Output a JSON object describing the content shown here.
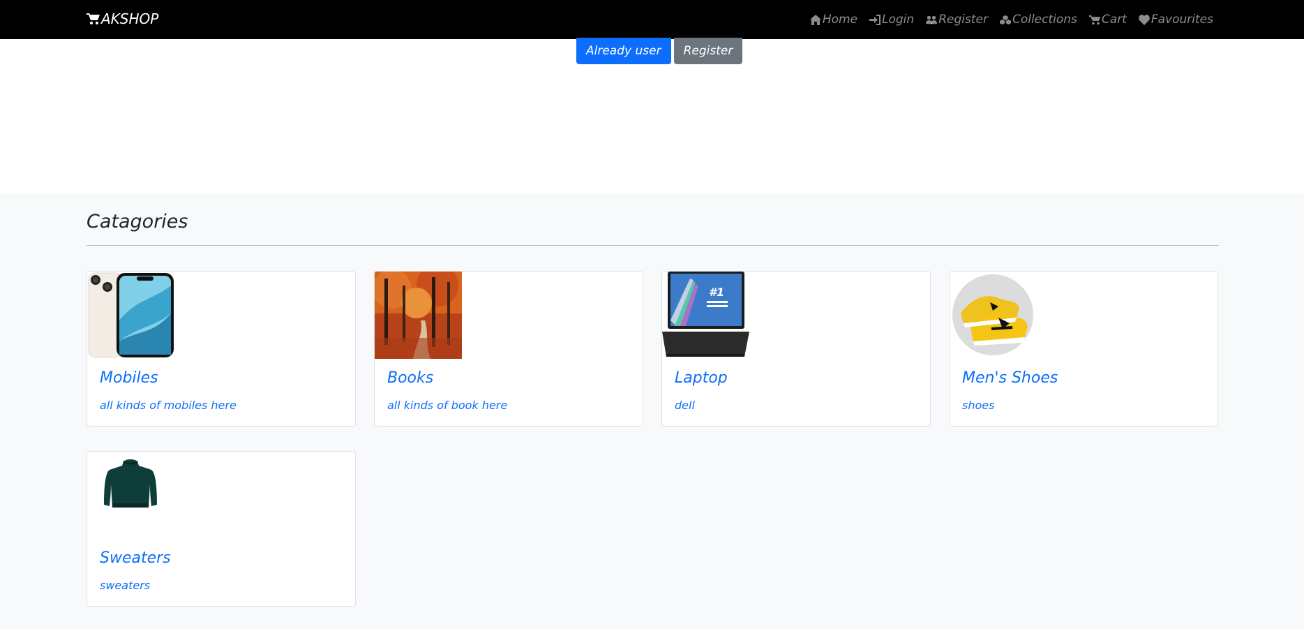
{
  "brand": {
    "name": "AKSHOP",
    "icon": "cart-icon"
  },
  "nav": [
    {
      "label": "Home",
      "icon": "home-icon"
    },
    {
      "label": "Login",
      "icon": "login-icon"
    },
    {
      "label": "Register",
      "icon": "users-icon"
    },
    {
      "label": "Collections",
      "icon": "cubes-icon"
    },
    {
      "label": "Cart",
      "icon": "cart-icon"
    },
    {
      "label": "Favourites",
      "icon": "heart-icon"
    }
  ],
  "hero": {
    "primary_label": "Already user",
    "secondary_label": "Register"
  },
  "colors": {
    "navbar": "#000000",
    "primary": "#0d6efd",
    "secondary": "#6c757d",
    "section_bg": "#f8f9fa"
  },
  "categories_section": {
    "title": "Catagories",
    "items": [
      {
        "title": "Mobiles",
        "description": "all kinds of mobiles here",
        "image": "phone-image"
      },
      {
        "title": "Books",
        "description": "all kinds of book here",
        "image": "forest-image"
      },
      {
        "title": "Laptop",
        "description": "dell",
        "image": "laptop-image"
      },
      {
        "title": "Men's Shoes",
        "description": "shoes",
        "image": "shoes-image"
      },
      {
        "title": "Sweaters",
        "description": "sweaters",
        "image": "sweater-image"
      }
    ]
  }
}
